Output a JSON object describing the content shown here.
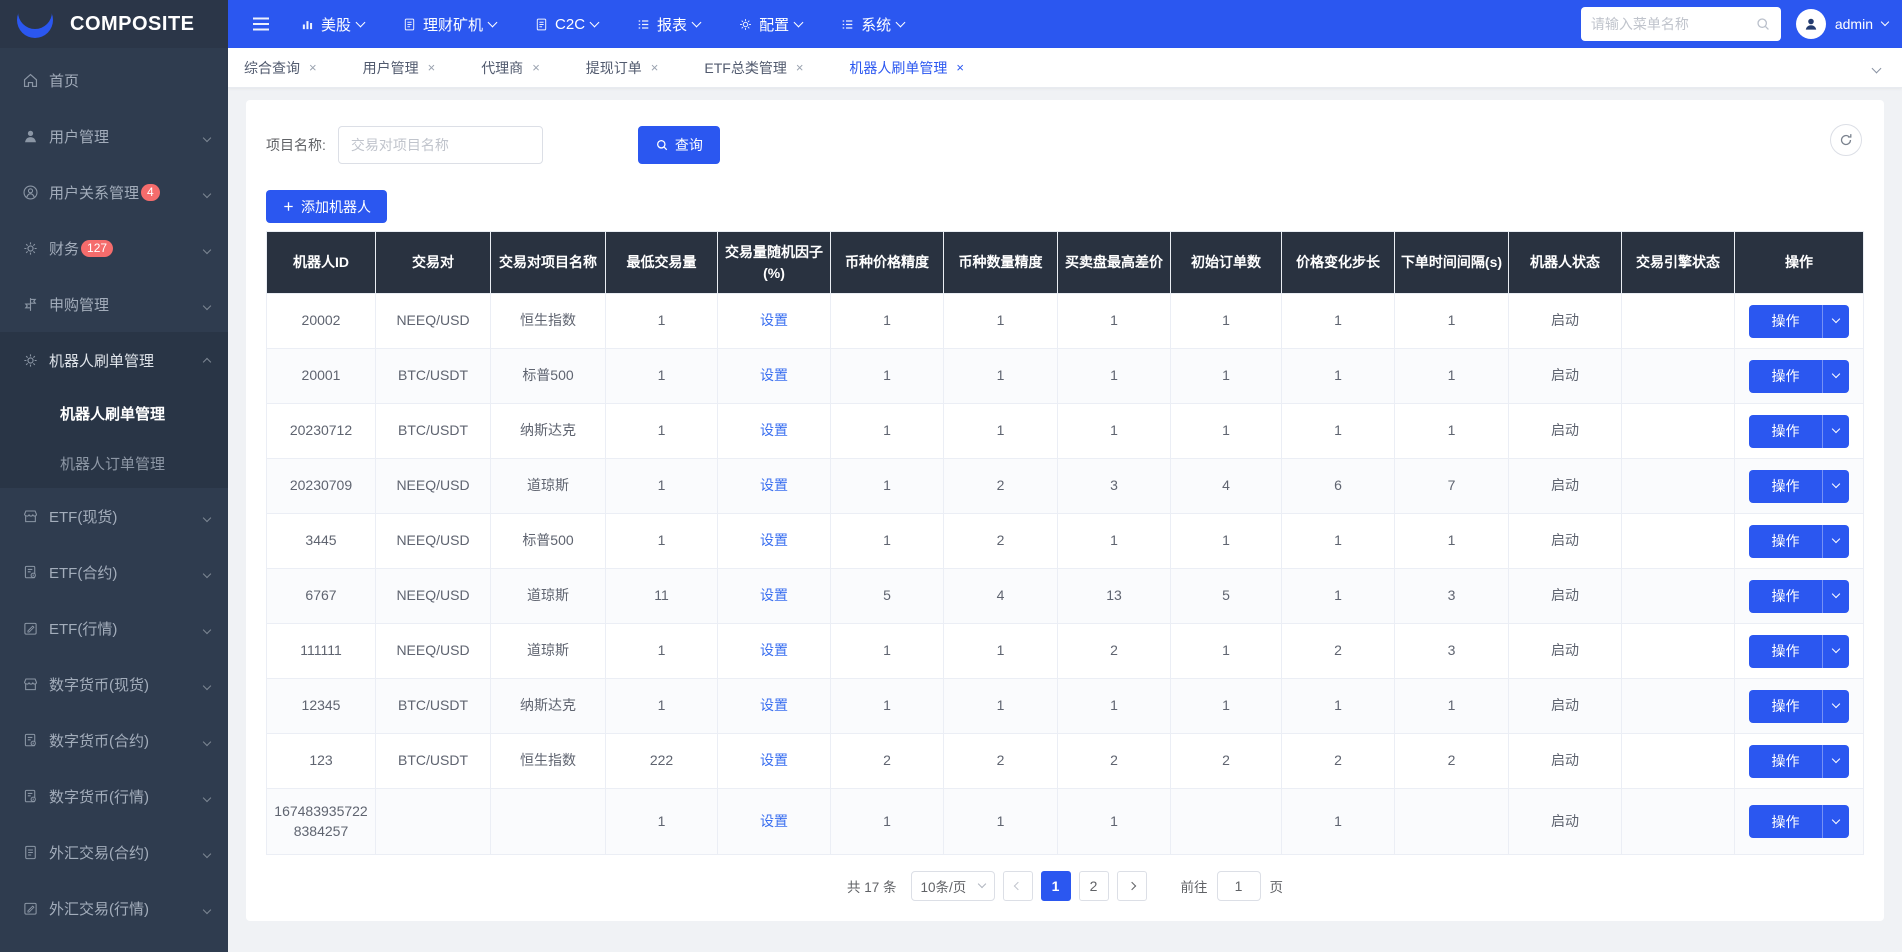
{
  "colors": {
    "accent": "#2b57f0",
    "topbar_dark": "#2b3648",
    "sidebar_bg": "#2f3c4f",
    "submenu_bg": "#293546",
    "table_header_bg": "#293240",
    "badge": "#f56c6c",
    "link": "#3a6ff0"
  },
  "brand": {
    "name": "COMPOSITE"
  },
  "topbar": {
    "menus": [
      {
        "label": "美股",
        "icon": "chart-bar-icon"
      },
      {
        "label": "理财矿机",
        "icon": "document-icon"
      },
      {
        "label": "C2C",
        "icon": "document-icon"
      },
      {
        "label": "报表",
        "icon": "list-icon"
      },
      {
        "label": "配置",
        "icon": "gear-icon"
      },
      {
        "label": "系统",
        "icon": "list-icon"
      }
    ],
    "search_placeholder": "请输入菜单名称",
    "username": "admin"
  },
  "tabs": [
    {
      "label": "综合查询",
      "active": false
    },
    {
      "label": "用户管理",
      "active": false
    },
    {
      "label": "代理商",
      "active": false
    },
    {
      "label": "提现订单",
      "active": false
    },
    {
      "label": "ETF总类管理",
      "active": false
    },
    {
      "label": "机器人刷单管理",
      "active": true
    }
  ],
  "sidebar": {
    "items": [
      {
        "label": "首页",
        "icon": "home-icon",
        "arrow": false
      },
      {
        "label": "用户管理",
        "icon": "user-icon",
        "arrow": true
      },
      {
        "label": "用户关系管理",
        "icon": "user-circle-icon",
        "badge": "4",
        "arrow": true
      },
      {
        "label": "财务",
        "icon": "gear-icon",
        "badge": "127",
        "arrow": true
      },
      {
        "label": "申购管理",
        "icon": "guide-icon",
        "arrow": true
      },
      {
        "label": "机器人刷单管理",
        "icon": "gear-icon",
        "arrow": true,
        "expanded": true,
        "children": [
          {
            "label": "机器人刷单管理",
            "active": true
          },
          {
            "label": "机器人订单管理",
            "active": false
          }
        ]
      },
      {
        "label": "ETF(现货)",
        "icon": "shop-icon",
        "arrow": true
      },
      {
        "label": "ETF(合约)",
        "icon": "doc-gear-icon",
        "arrow": true
      },
      {
        "label": "ETF(行情)",
        "icon": "edit-icon",
        "arrow": true
      },
      {
        "label": "数字货币(现货)",
        "icon": "shop-icon",
        "arrow": true
      },
      {
        "label": "数字货币(合约)",
        "icon": "doc-gear-icon",
        "arrow": true
      },
      {
        "label": "数字货币(行情)",
        "icon": "doc-gear-icon",
        "arrow": true
      },
      {
        "label": "外汇交易(合约)",
        "icon": "document-icon",
        "arrow": true
      },
      {
        "label": "外汇交易(行情)",
        "icon": "edit-icon",
        "arrow": true
      }
    ]
  },
  "filter": {
    "label": "项目名称:",
    "placeholder": "交易对项目名称",
    "query_button": "查询",
    "add_button": "添加机器人"
  },
  "table": {
    "headers": [
      "机器人ID",
      "交易对",
      "交易对项目名称",
      "最低交易量",
      "交易量随机因子(%)",
      "币种价格精度",
      "币种数量精度",
      "买卖盘最高差价",
      "初始订单数",
      "价格变化步长",
      "下单时间间隔(s)",
      "机器人状态",
      "交易引擎状态",
      "操作"
    ],
    "set_link": "设置",
    "action_button": "操作",
    "rows": [
      {
        "id": "20002",
        "pair": "NEEQ/USD",
        "project": "恒生指数",
        "min_volume": "1",
        "price_precision": "1",
        "qty_precision": "1",
        "max_spread": "1",
        "init_orders": "1",
        "price_step": "1",
        "interval": "1",
        "robot_status": "启动",
        "engine_status": ""
      },
      {
        "id": "20001",
        "pair": "BTC/USDT",
        "project": "标普500",
        "min_volume": "1",
        "price_precision": "1",
        "qty_precision": "1",
        "max_spread": "1",
        "init_orders": "1",
        "price_step": "1",
        "interval": "1",
        "robot_status": "启动",
        "engine_status": ""
      },
      {
        "id": "20230712",
        "pair": "BTC/USDT",
        "project": "纳斯达克",
        "min_volume": "1",
        "price_precision": "1",
        "qty_precision": "1",
        "max_spread": "1",
        "init_orders": "1",
        "price_step": "1",
        "interval": "1",
        "robot_status": "启动",
        "engine_status": ""
      },
      {
        "id": "20230709",
        "pair": "NEEQ/USD",
        "project": "道琼斯",
        "min_volume": "1",
        "price_precision": "1",
        "qty_precision": "2",
        "max_spread": "3",
        "init_orders": "4",
        "price_step": "6",
        "interval": "7",
        "robot_status": "启动",
        "engine_status": ""
      },
      {
        "id": "3445",
        "pair": "NEEQ/USD",
        "project": "标普500",
        "min_volume": "1",
        "price_precision": "1",
        "qty_precision": "2",
        "max_spread": "1",
        "init_orders": "1",
        "price_step": "1",
        "interval": "1",
        "robot_status": "启动",
        "engine_status": ""
      },
      {
        "id": "6767",
        "pair": "NEEQ/USD",
        "project": "道琼斯",
        "min_volume": "11",
        "price_precision": "5",
        "qty_precision": "4",
        "max_spread": "13",
        "init_orders": "5",
        "price_step": "1",
        "interval": "3",
        "robot_status": "启动",
        "engine_status": ""
      },
      {
        "id": "111111",
        "pair": "NEEQ/USD",
        "project": "道琼斯",
        "min_volume": "1",
        "price_precision": "1",
        "qty_precision": "1",
        "max_spread": "2",
        "init_orders": "1",
        "price_step": "2",
        "interval": "3",
        "robot_status": "启动",
        "engine_status": ""
      },
      {
        "id": "12345",
        "pair": "BTC/USDT",
        "project": "纳斯达克",
        "min_volume": "1",
        "price_precision": "1",
        "qty_precision": "1",
        "max_spread": "1",
        "init_orders": "1",
        "price_step": "1",
        "interval": "1",
        "robot_status": "启动",
        "engine_status": ""
      },
      {
        "id": "123",
        "pair": "BTC/USDT",
        "project": "恒生指数",
        "min_volume": "222",
        "price_precision": "2",
        "qty_precision": "2",
        "max_spread": "2",
        "init_orders": "2",
        "price_step": "2",
        "interval": "2",
        "robot_status": "启动",
        "engine_status": ""
      },
      {
        "id": "1674839357228384257",
        "pair": "",
        "project": "",
        "min_volume": "1",
        "price_precision": "1",
        "qty_precision": "1",
        "max_spread": "1",
        "init_orders": "",
        "price_step": "1",
        "interval": "",
        "robot_status": "启动",
        "engine_status": ""
      }
    ]
  },
  "pagination": {
    "total": "共 17 条",
    "page_size": "10条/页",
    "pages": [
      "1",
      "2"
    ],
    "active_page": "1",
    "goto_label": "前往",
    "goto_value": "1",
    "goto_unit": "页"
  }
}
